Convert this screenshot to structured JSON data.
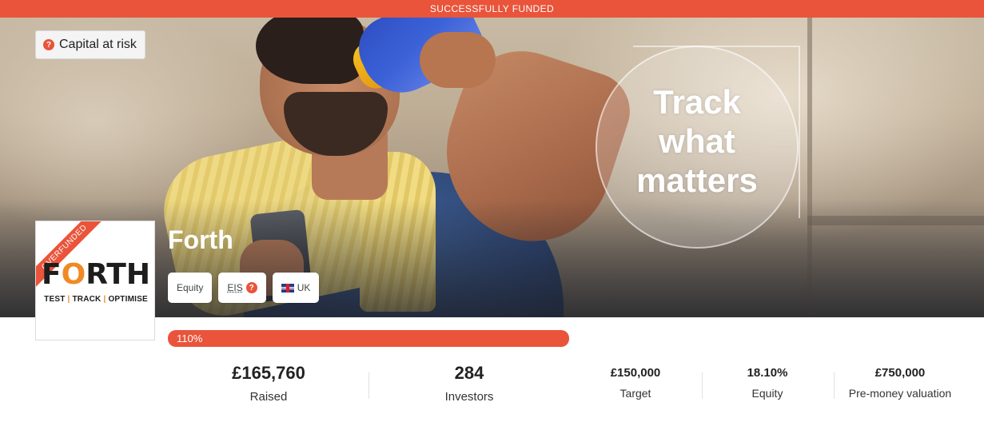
{
  "banner": {
    "status": "SUCCESSFULLY FUNDED"
  },
  "risk": {
    "label": "Capital at risk",
    "icon": "question-icon"
  },
  "hero": {
    "tagline": [
      "Track",
      "what",
      "matters"
    ]
  },
  "logo": {
    "ribbon": "OVERFUNDED",
    "word_start": "F",
    "word_o": "O",
    "word_end": "RTH",
    "tag_parts": [
      "TEST",
      "TRACK",
      "OPTIMISE"
    ],
    "tag_separator": "|"
  },
  "company": {
    "name": "Forth",
    "chips": [
      {
        "label": "Equity"
      },
      {
        "label": "EIS",
        "icon": "question-icon"
      },
      {
        "label": "UK",
        "icon": "uk-flag-icon"
      }
    ]
  },
  "progress": {
    "label": "110%",
    "percent": 110
  },
  "stats": [
    {
      "value": "£165,760",
      "label": "Raised"
    },
    {
      "value": "284",
      "label": "Investors"
    },
    {
      "value": "£150,000",
      "label": "Target"
    },
    {
      "value": "18.10%",
      "label": "Equity"
    },
    {
      "value": "£750,000",
      "label": "Pre-money valuation"
    }
  ],
  "colors": {
    "brand": "#e9543a",
    "logo_accent": "#f08a24"
  }
}
